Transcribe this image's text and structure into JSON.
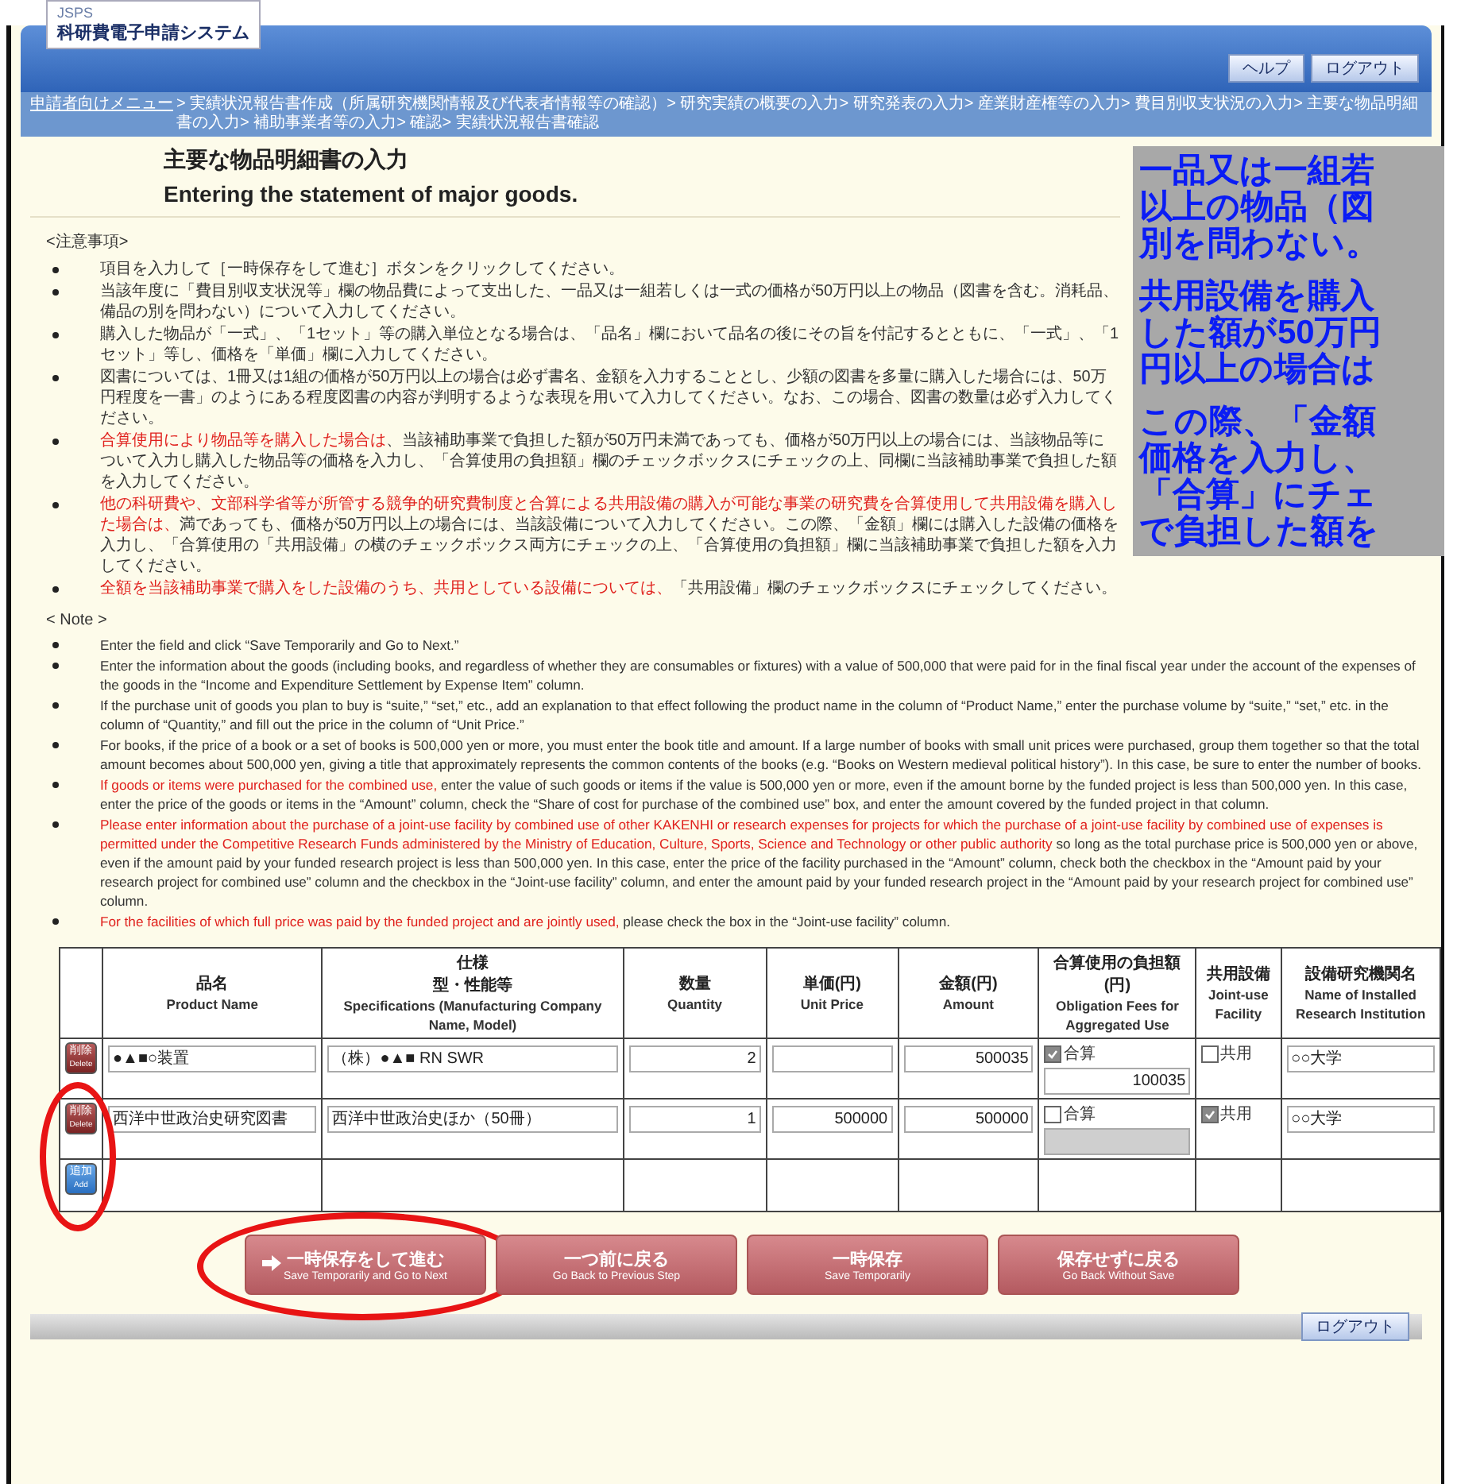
{
  "header": {
    "logo_small": "JSPS",
    "logo": "科研費電子申請システム",
    "buttons": [
      {
        "label": "ヘルプ"
      },
      {
        "label": "ログアウト"
      }
    ]
  },
  "breadcrumb": [
    {
      "label": "申請者向けメニュー",
      "link": true
    },
    {
      "label": "> 実績状況報告書作成（所属研究機関情報及び代表者情報等の確認）> 研究実績の概要の入力> 研究発表の入力> 産業財産権等の入力> 費目別収支状況の入力> 主要な物品明細書の入力> 補助事業者等の入力> 確認> 実績状況報告書確認",
      "link": false
    }
  ],
  "title": {
    "ja": "主要な物品明細書の入力",
    "en": "Entering the statement of major goods."
  },
  "callout": [
    [
      "一品又は一組若",
      "以上の物品（図",
      "別を問わない。"
    ],
    [
      "共用設備を購入",
      "した額が50万円",
      "円以上の場合は"
    ],
    [
      "この際、「金額",
      "価格を入力し、",
      "「合算」にチェ",
      "で負担した額を"
    ]
  ],
  "notes_ja": {
    "heading": "<注意事項>",
    "items": [
      [
        {
          "text": "項目を入力して［一時保存をして進む］ボタンをクリックしてください。",
          "red": false
        }
      ],
      [
        {
          "text": "当該年度に「費目別収支状況等」欄の物品費によって支出した、一品又は一組若しくは一式の価格が50万円以上の物品（図書を含む。消耗品、備品の別を問わない）について入力してください。",
          "red": false
        }
      ],
      [
        {
          "text": "購入した物品が「一式」、「1セット」等の購入単位となる場合は、「品名」欄において品名の後にその旨を付記するとともに、「一式」、「1セット」等し、価格を「単価」欄に入力してください。",
          "red": false
        }
      ],
      [
        {
          "text": "図書については、1冊又は1組の価格が50万円以上の場合は必ず書名、金額を入力することとし、少額の図書を多量に購入した場合には、50万円程度を一書」のようにある程度図書の内容が判明するような表現を用いて入力してください。なお、この場合、図書の数量は必ず入力してください。",
          "red": false
        }
      ],
      [
        {
          "text": "合算使用により物品等を購入した場合は",
          "red": true
        },
        {
          "text": "、当該補助事業で負担した額が50万円未満であっても、価格が50万円以上の場合には、当該物品等について入力し購入した物品等の価格を入力し、「合算使用の負担額」欄のチェックボックスにチェックの上、同欄に当該補助事業で負担した額を入力してください。",
          "red": false
        }
      ],
      [
        {
          "text": "他の科研費や、文部科学省等が所管する競争的研究費制度と合算による共用設備の購入が可能な事業の研究費を合算使用して共用設備を購入した場合は、",
          "red": true
        },
        {
          "text": "満であっても、価格が50万円以上の場合には、当該設備について入力してください。この際、「金額」欄には購入した設備の価格を入力し、「合算使用の「共用設備」の横のチェックボックス両方にチェックの上、「合算使用の負担額」欄に当該補助事業で負担した額を入力してください。",
          "red": false
        }
      ],
      [
        {
          "text": "全額を当該補助事業で購入をした設備のうち、共用としている設備については、",
          "red": true
        },
        {
          "text": "「共用設備」欄のチェックボックスにチェックしてください。",
          "red": false
        }
      ]
    ]
  },
  "notes_en": {
    "heading": "< Note >",
    "items": [
      [
        {
          "text": "Enter the field and click “Save Temporarily and Go to Next.”",
          "red": false
        }
      ],
      [
        {
          "text": "Enter the information about the goods (including books, and regardless of whether they are consumables or fixtures) with a value of 500,000 that were paid for in the final fiscal year under the account of the expenses of the goods in the “Income and Expenditure Settlement by Expense Item” column.",
          "red": false
        }
      ],
      [
        {
          "text": "If the purchase unit of goods you plan to buy is “suite,” “set,” etc., add an explanation to that effect following the product name in the column of “Product Name,” enter the purchase volume by “suite,” “set,” etc. in the column of “Quantity,” and fill out the price in the column of “Unit Price.”",
          "red": false
        }
      ],
      [
        {
          "text": "For books, if the price of a book or a set of books is 500,000 yen or more, you must enter the book title and amount. If a large number of books with small unit prices were purchased, group them together so that the total amount becomes about 500,000 yen, giving a title that approximately represents the common contents of the books (e.g. “Books on Western medieval political history”). In this case, be sure to enter the number of books.",
          "red": false
        }
      ],
      [
        {
          "text": "If goods or items were purchased for the combined use,",
          "red": true
        },
        {
          "text": " enter the value of such goods or items if the value is 500,000 yen or more, even if the amount borne by the funded project is less than 500,000 yen. In this case, enter the price of the goods or items in the “Amount” column, check the “Share of cost for purchase of the combined use” box, and enter the amount covered by the funded project in that column.",
          "red": false
        }
      ],
      [
        {
          "text": "Please enter information about the purchase of a joint-use facility by combined use of other KAKENHI or research expenses for projects for which the purchase of a joint-use facility by combined use of expenses is permitted under the Competitive Research Funds administered by the Ministry of Education, Culture, Sports, Science and Technology or other public authority",
          "red": true
        },
        {
          "text": " so long as the total purchase price is 500,000 yen or above, even if the amount paid by your funded research project is less than 500,000 yen. In this case, enter the price of the facility purchased in the “Amount” column, check both the checkbox in the “Amount paid by your research project for combined use” column and the checkbox in the “Joint-use facility” column, and enter the amount paid by your funded research project in the “Amount paid by your research project for combined use” column.",
          "red": false
        }
      ],
      [
        {
          "text": "For the facilities of which full price was paid by the funded project and are jointly used,",
          "red": true
        },
        {
          "text": " please check the box in the “Joint-use facility” column.",
          "red": false
        }
      ]
    ]
  },
  "table": {
    "columns": [
      {
        "ja": [
          "品名"
        ],
        "en": "Product Name"
      },
      {
        "ja": [
          "仕様",
          "型・性能等"
        ],
        "en": "Specifications (Manufacturing Company Name, Model)"
      },
      {
        "ja": [
          "数量"
        ],
        "en": "Quantity"
      },
      {
        "ja": [
          "単価(円)"
        ],
        "en": "Unit Price"
      },
      {
        "ja": [
          "金額(円)"
        ],
        "en": "Amount"
      },
      {
        "ja": [
          "合算使用の負担額(円)"
        ],
        "en": "Obligation Fees for Aggregated Use"
      },
      {
        "ja": [
          "共用設備"
        ],
        "en": "Joint-use Facility"
      },
      {
        "ja": [
          "設備研究機関名"
        ],
        "en": "Name of Installed Research Institution"
      }
    ],
    "rows": [
      {
        "action": {
          "kind": "delete",
          "ja": "削除",
          "en": "Delete"
        },
        "product": "●▲■○装置",
        "spec": "（株）●▲■ RN SWR",
        "quantity": "2",
        "unit_price": "",
        "amount": "500035",
        "combined": {
          "checked": true,
          "label": "合算",
          "value": "100035"
        },
        "joint": {
          "checked": false,
          "label": "共用"
        },
        "institution": "○○大学"
      },
      {
        "action": {
          "kind": "delete",
          "ja": "削除",
          "en": "Delete"
        },
        "product": "西洋中世政治史研究図書",
        "spec": "西洋中世政治史ほか（50冊）",
        "quantity": "1",
        "unit_price": "500000",
        "amount": "500000",
        "combined": {
          "checked": false,
          "label": "合算"
        },
        "joint": {
          "checked": true,
          "label": "共用"
        },
        "institution": "○○大学"
      },
      {
        "action": {
          "kind": "add",
          "ja": "追加",
          "en": "Add"
        }
      }
    ]
  },
  "buttons": [
    {
      "ja": "一時保存をして進む",
      "en": "Save Temporarily and Go to Next",
      "arrow": true
    },
    {
      "ja": "一つ前に戻る",
      "en": "Go Back to Previous Step",
      "arrow": false
    },
    {
      "ja": "一時保存",
      "en": "Save Temporarily",
      "arrow": false
    },
    {
      "ja": "保存せずに戻る",
      "en": "Go Back Without Save",
      "arrow": false
    }
  ],
  "footer": {
    "button": "ログアウト"
  }
}
